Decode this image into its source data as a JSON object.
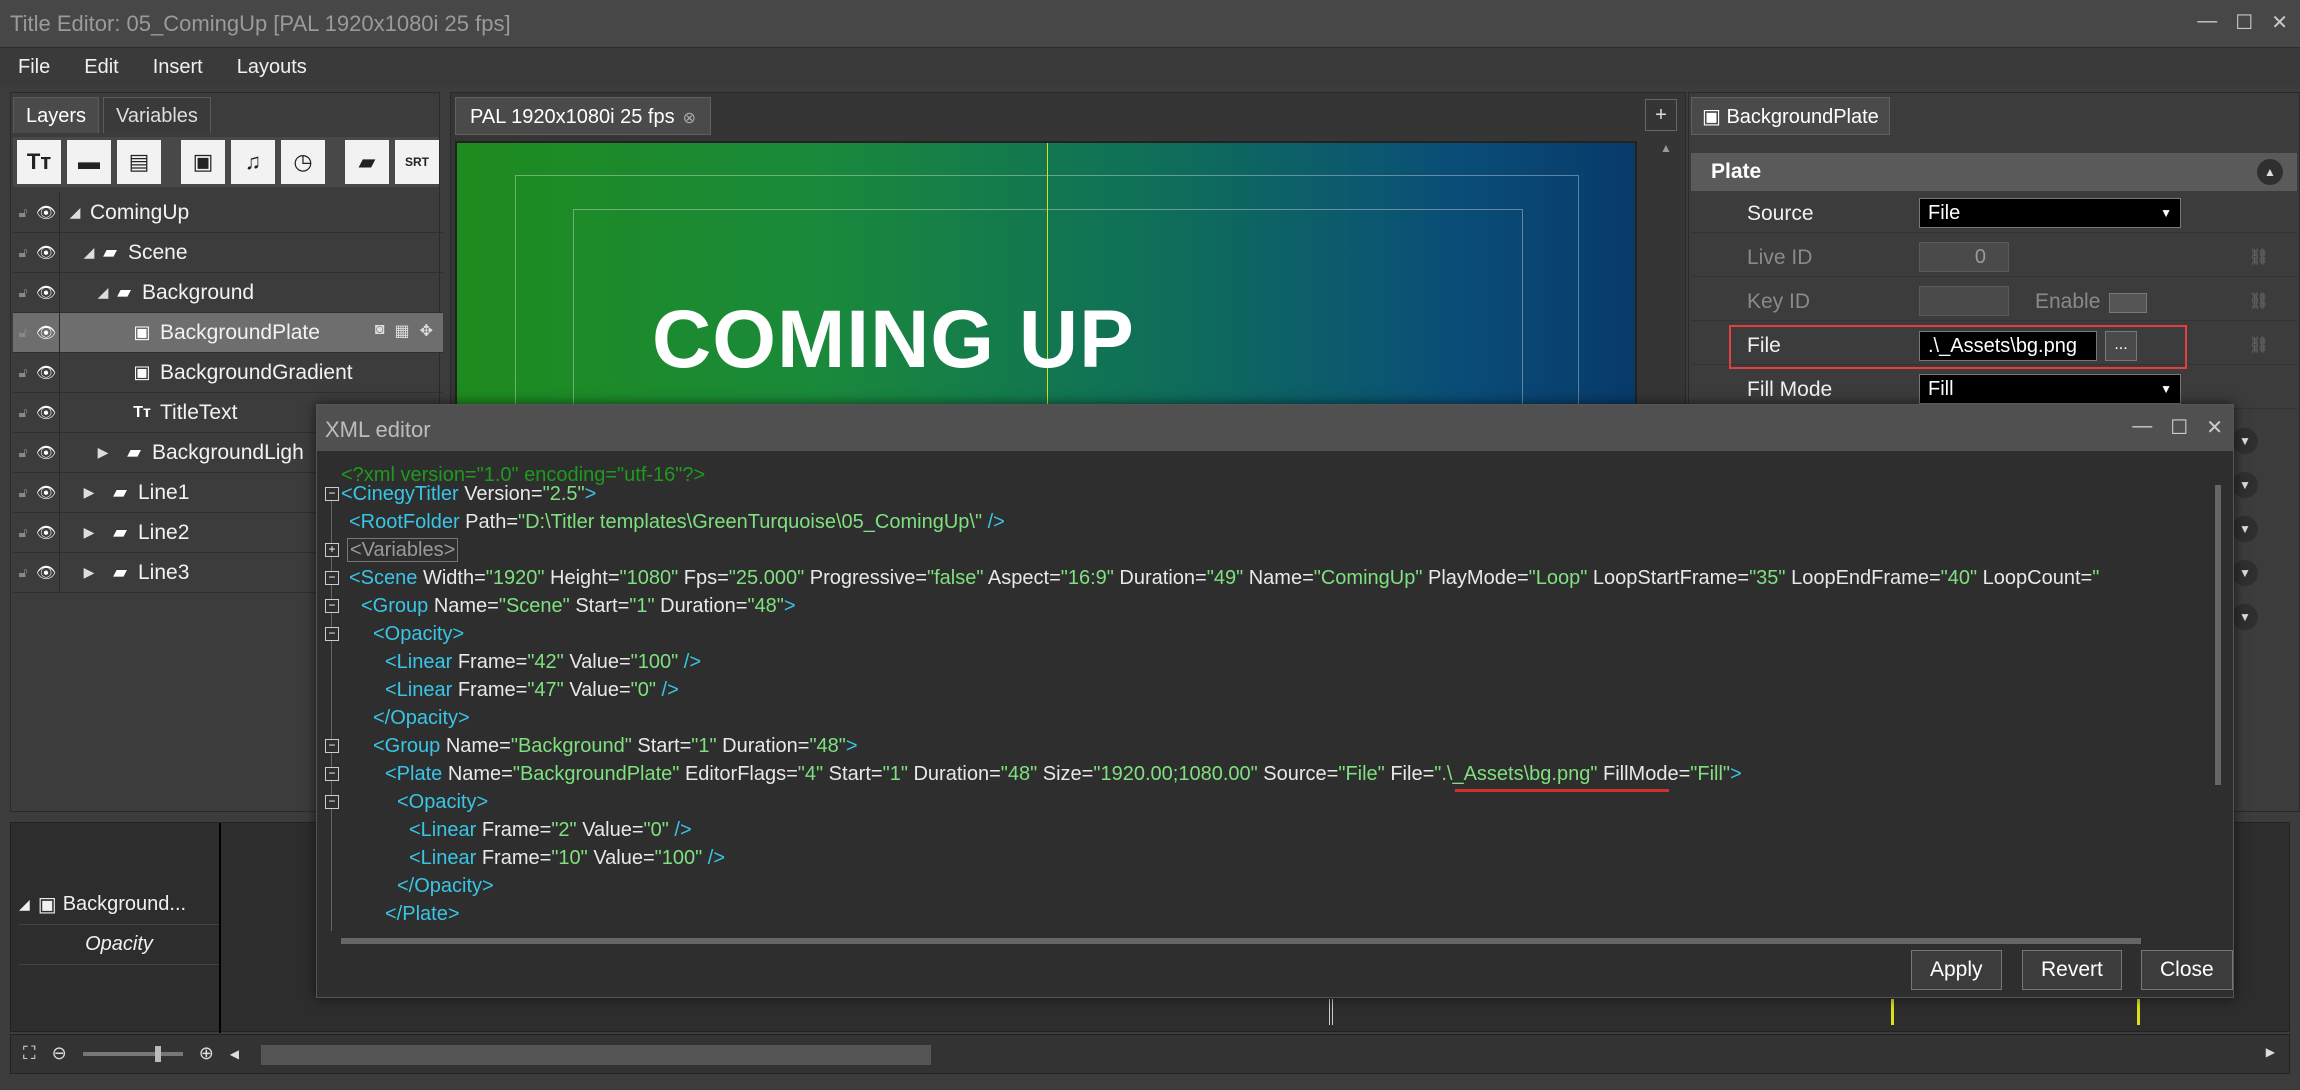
{
  "window": {
    "title": "Title Editor: 05_ComingUp [PAL 1920x1080i 25 fps]"
  },
  "menu": [
    "File",
    "Edit",
    "Insert",
    "Layouts"
  ],
  "left_tabs": [
    "Layers",
    "Variables"
  ],
  "tree": [
    {
      "label": "ComingUp"
    },
    {
      "label": "Scene"
    },
    {
      "label": "Background"
    },
    {
      "label": "BackgroundPlate"
    },
    {
      "label": "BackgroundGradient"
    },
    {
      "label": "TitleText"
    },
    {
      "label": "BackgroundLigh"
    },
    {
      "label": "Line1"
    },
    {
      "label": "Line2"
    },
    {
      "label": "Line3"
    }
  ],
  "canvas": {
    "tab_label": "PAL 1920x1080i 25 fps",
    "preview_text": "COMING UP"
  },
  "properties": {
    "tab_label": "BackgroundPlate",
    "section": "Plate",
    "source_label": "Source",
    "source_value": "File",
    "live_id_label": "Live ID",
    "live_id_value": "0",
    "key_id_label": "Key ID",
    "enable_label": "Enable",
    "file_label": "File",
    "file_value": ".\\_Assets\\bg.png",
    "browse_label": "...",
    "fill_mode_label": "Fill Mode",
    "fill_mode_value": "Fill"
  },
  "timeline": {
    "track_label": "Background...",
    "property_label": "Opacity"
  },
  "xml_editor": {
    "title": "XML editor",
    "buttons": {
      "apply": "Apply",
      "revert": "Revert",
      "close": "Close"
    },
    "lines": {
      "l0": "<?xml version=\"1.0\" encoding=\"utf-16\"?>",
      "l1_tag": "<CinegyTitler",
      "l1_a": " Version=",
      "l1_v": "\"2.5\"",
      "l1_e": ">",
      "l2_tag": "<RootFolder",
      "l2_a": " Path=",
      "l2_v": "\"D:\\Titler templates\\GreenTurquoise\\05_ComingUp\\\"",
      "l2_e": " />",
      "l3": "<Variables>",
      "l4_tag": "<Scene",
      "l4_a1": " Width=",
      "l4_v1": "\"1920\"",
      "l4_a2": " Height=",
      "l4_v2": "\"1080\"",
      "l4_a3": " Fps=",
      "l4_v3": "\"25.000\"",
      "l4_a4": " Progressive=",
      "l4_v4": "\"false\"",
      "l4_a5": " Aspect=",
      "l4_v5": "\"16:9\"",
      "l4_a6": " Duration=",
      "l4_v6": "\"49\"",
      "l4_a7": " Name=",
      "l4_v7": "\"ComingUp\"",
      "l4_a8": " PlayMode=",
      "l4_v8": "\"Loop\"",
      "l4_a9": " LoopStartFrame=",
      "l4_v9": "\"35\"",
      "l4_a10": " LoopEndFrame=",
      "l4_v10": "\"40\"",
      "l4_a11": " LoopCount=",
      "l4_v11": "\"",
      "l5_tag": "<Group",
      "l5_a1": " Name=",
      "l5_v1": "\"Scene\"",
      "l5_a2": " Start=",
      "l5_v2": "\"1\"",
      "l5_a3": " Duration=",
      "l5_v3": "\"48\"",
      "l5_e": ">",
      "l6": "<Opacity>",
      "l7_tag": "<Linear",
      "l7_a1": " Frame=",
      "l7_v1": "\"42\"",
      "l7_a2": " Value=",
      "l7_v2": "\"100\"",
      "l7_e": " />",
      "l8_tag": "<Linear",
      "l8_a1": " Frame=",
      "l8_v1": "\"47\"",
      "l8_a2": " Value=",
      "l8_v2": "\"0\"",
      "l8_e": " />",
      "l9": "</Opacity>",
      "l10_tag": "<Group",
      "l10_a1": " Name=",
      "l10_v1": "\"Background\"",
      "l10_a2": " Start=",
      "l10_v2": "\"1\"",
      "l10_a3": " Duration=",
      "l10_v3": "\"48\"",
      "l10_e": ">",
      "l11_tag": "<Plate",
      "l11_a1": " Name=",
      "l11_v1": "\"BackgroundPlate\"",
      "l11_a2": " EditorFlags=",
      "l11_v2": "\"4\"",
      "l11_a3": " Start=",
      "l11_v3": "\"1\"",
      "l11_a4": " Duration=",
      "l11_v4": "\"48\"",
      "l11_a5": " Size=",
      "l11_v5": "\"1920.00;1080.00\"",
      "l11_a6": " Source=",
      "l11_v6": "\"File\"",
      "l11_a7": " File=",
      "l11_v7": "\".\\_Assets\\bg.png\"",
      "l11_a8": " FillMode=",
      "l11_v8": "\"Fill\"",
      "l11_e": ">",
      "l12": "<Opacity>",
      "l13_tag": "<Linear",
      "l13_a1": " Frame=",
      "l13_v1": "\"2\"",
      "l13_a2": " Value=",
      "l13_v2": "\"0\"",
      "l13_e": " />",
      "l14_tag": "<Linear",
      "l14_a1": " Frame=",
      "l14_v1": "\"10\"",
      "l14_a2": " Value=",
      "l14_v2": "\"100\"",
      "l14_e": " />",
      "l15": "</Opacity>",
      "l16": "</Plate>"
    }
  },
  "colors": {
    "tag": "#39c6e6",
    "value": "#7fe07f",
    "highlight": "#e24040"
  }
}
